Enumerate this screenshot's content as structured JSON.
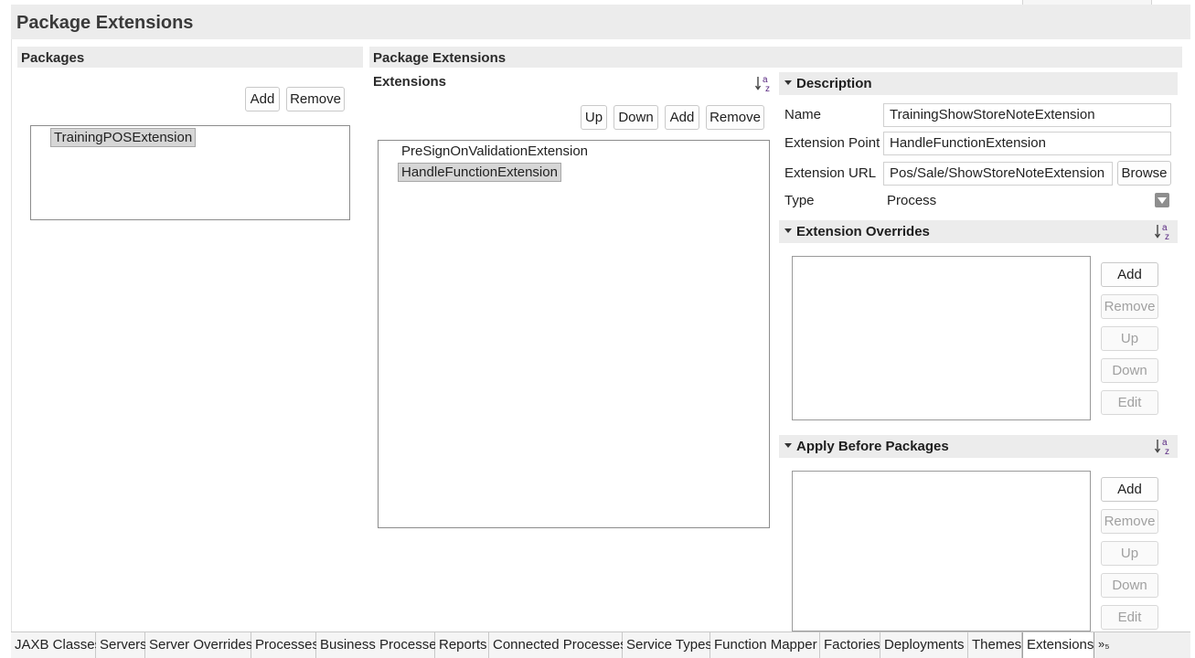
{
  "page": {
    "title": "Package Extensions"
  },
  "packages": {
    "header": "Packages",
    "add_label": "Add",
    "remove_label": "Remove",
    "items": [
      "TrainingPOSExtension"
    ]
  },
  "package_extensions": {
    "header": "Package Extensions",
    "extensions_label": "Extensions",
    "buttons": {
      "up": "Up",
      "down": "Down",
      "add": "Add",
      "remove": "Remove"
    },
    "items": [
      "PreSignOnValidationExtension",
      "HandleFunctionExtension"
    ]
  },
  "description": {
    "header": "Description",
    "name_label": "Name",
    "name_value": "TrainingShowStoreNoteExtension",
    "ext_point_label": "Extension Point",
    "ext_point_value": "HandleFunctionExtension",
    "ext_url_label": "Extension URL",
    "ext_url_value": "Pos/Sale/ShowStoreNoteExtension",
    "browse_label": "Browse",
    "type_label": "Type",
    "type_value": "Process"
  },
  "extension_overrides": {
    "header": "Extension Overrides",
    "buttons": {
      "add": "Add",
      "remove": "Remove",
      "up": "Up",
      "down": "Down",
      "edit": "Edit"
    }
  },
  "apply_before": {
    "header": "Apply Before Packages",
    "buttons": {
      "add": "Add",
      "remove": "Remove",
      "up": "Up",
      "down": "Down",
      "edit": "Edit"
    }
  },
  "tabs": [
    "JAXB Classes",
    "Servers",
    "Server Overrides",
    "Processes",
    "Business Processes",
    "Reports",
    "Connected Processes",
    "Service Types",
    "Function Mapper",
    "Factories",
    "Deployments",
    "Themes",
    "Extensions"
  ],
  "active_tab": "Extensions",
  "overflow_label": "»₅"
}
